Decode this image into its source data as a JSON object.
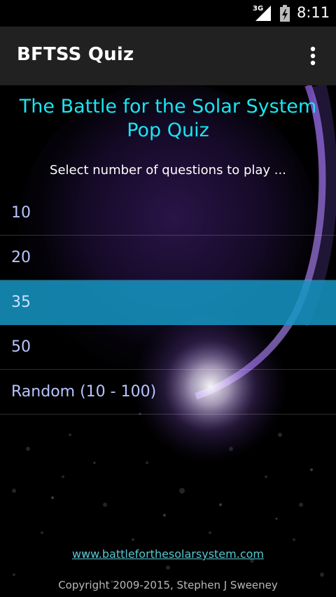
{
  "status_bar": {
    "network": "3G",
    "time": "8:11"
  },
  "action_bar": {
    "title": "BFTSS Quiz",
    "overflow_icon": "more-vertical-icon"
  },
  "main": {
    "title_line_1": "The Battle for the Solar System",
    "title_line_2": "Pop Quiz",
    "prompt": "Select number of questions to play ...",
    "options": [
      {
        "label": "10",
        "selected": false
      },
      {
        "label": "20",
        "selected": false
      },
      {
        "label": "35",
        "selected": true
      },
      {
        "label": "50",
        "selected": false
      },
      {
        "label": "Random (10 - 100)",
        "selected": false
      }
    ]
  },
  "footer": {
    "website": "www.battleforthesolarsystem.com",
    "copyright": "Copyright 2009-2015, Stephen J Sweeney"
  },
  "colors": {
    "title": "#19e6f2",
    "selected_row": "#1596c4",
    "option_text": "#b8c4ff",
    "action_bar": "#212121"
  }
}
